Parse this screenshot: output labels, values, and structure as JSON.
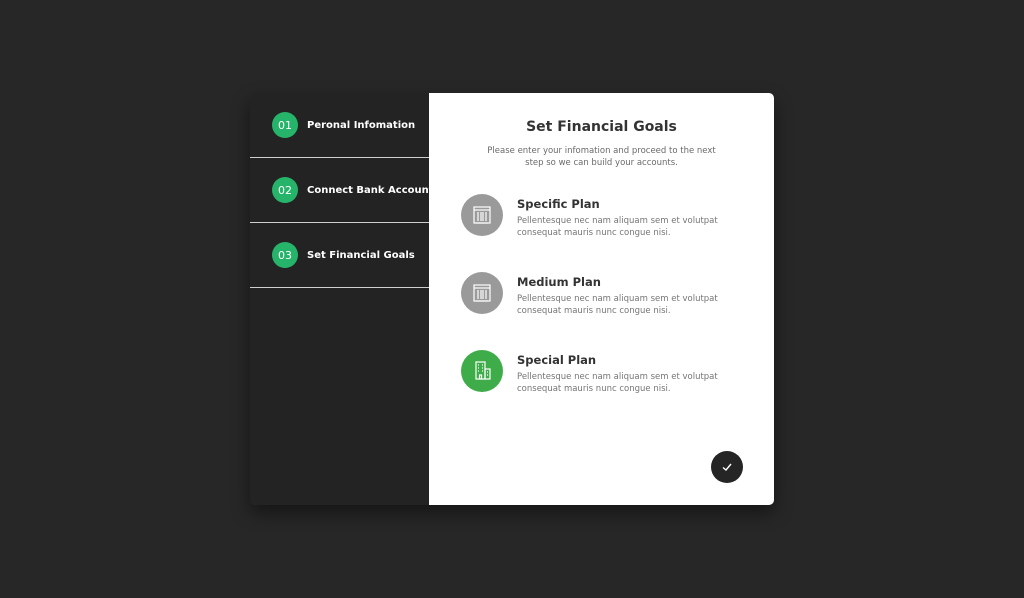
{
  "sidebar": {
    "steps": [
      {
        "number": "01",
        "label": "Peronal Infomation"
      },
      {
        "number": "02",
        "label": "Connect Bank Account"
      },
      {
        "number": "03",
        "label": "Set Financial Goals"
      }
    ]
  },
  "main": {
    "title": "Set Financial Goals",
    "subtitle": "Please enter your infomation and proceed to the next step so we can build your accounts.",
    "plans": [
      {
        "title": "Specific Plan",
        "description": "Pellentesque nec nam aliquam sem et volutpat consequat mauris nunc congue nisi.",
        "icon": "building-icon",
        "selected": false
      },
      {
        "title": "Medium Plan",
        "description": "Pellentesque nec nam aliquam sem et volutpat consequat mauris nunc congue nisi.",
        "icon": "building-icon",
        "selected": false
      },
      {
        "title": "Special Plan",
        "description": "Pellentesque nec nam aliquam sem et volutpat consequat mauris nunc congue nisi.",
        "icon": "buildings-icon",
        "selected": true
      }
    ],
    "submit_icon": "checkmark-icon"
  },
  "colors": {
    "page_background": "#272727",
    "sidebar_background": "#232323",
    "step_badge": "#26b36a",
    "plan_icon_inactive": "#9a9a9a",
    "plan_icon_active": "#3fac4a",
    "submit_button": "#252525"
  }
}
